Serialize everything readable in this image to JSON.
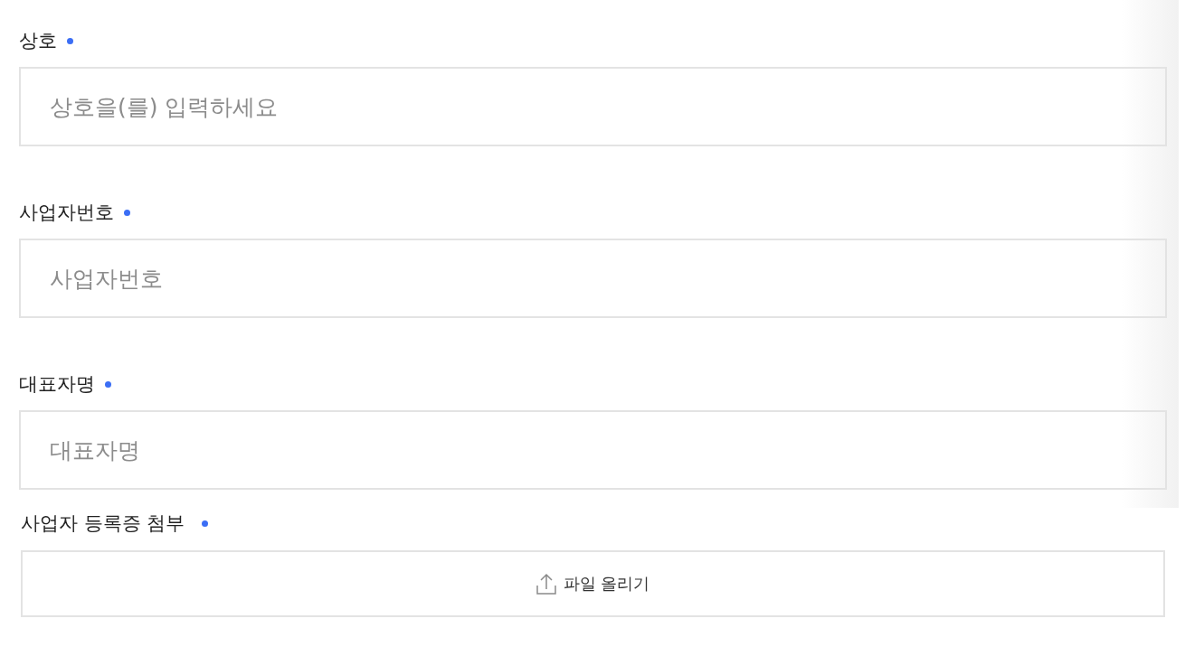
{
  "business_info": {
    "fields": [
      {
        "label": "상호",
        "required": true,
        "placeholder": "상호을(를) 입력하세요"
      },
      {
        "label": "사업자번호",
        "required": true,
        "placeholder": "사업자번호"
      },
      {
        "label": "대표자명",
        "required": true,
        "placeholder": "대표자명"
      }
    ]
  },
  "attachment": {
    "label": "사업자 등록증 첨부",
    "required": true,
    "button": "파일 올리기"
  }
}
